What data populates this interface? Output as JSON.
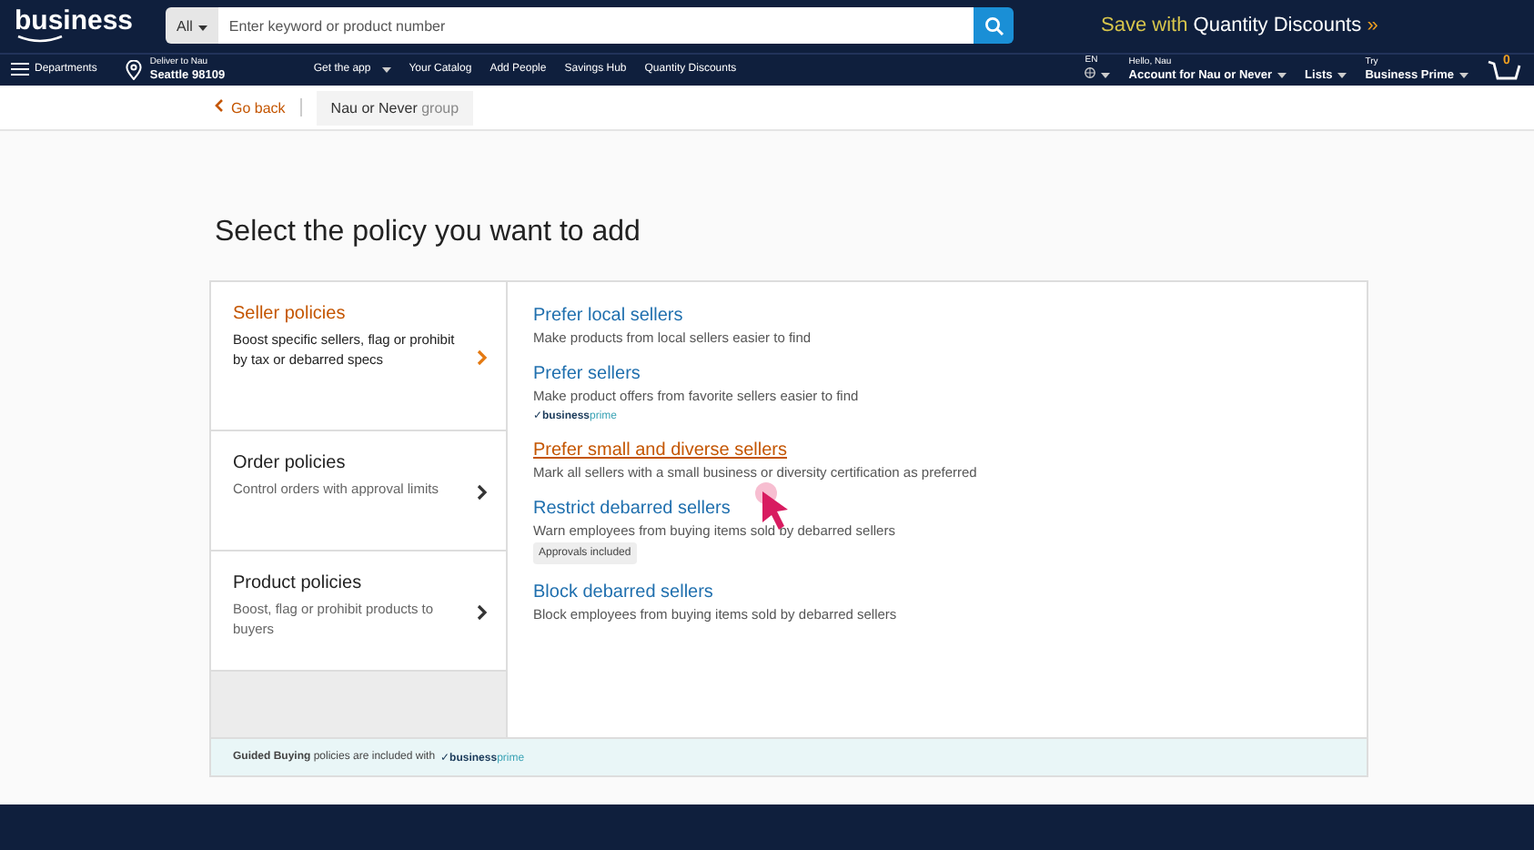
{
  "header": {
    "logo": "business",
    "search": {
      "scope": "All",
      "placeholder": "Enter keyword or product number"
    },
    "promo": {
      "lead": "Save with",
      "main": "Quantity Discounts",
      "arrow": "»"
    }
  },
  "nav": {
    "departments": "Departments",
    "deliver_line1": "Deliver to Nau",
    "deliver_line2": "Seattle 98109",
    "links": [
      {
        "label": "Get the app",
        "dropdown": true
      },
      {
        "label": "Your Catalog",
        "dropdown": false
      },
      {
        "label": "Add People",
        "dropdown": false
      },
      {
        "label": "Savings Hub",
        "dropdown": false
      },
      {
        "label": "Quantity Discounts",
        "dropdown": false
      }
    ],
    "language": "EN",
    "account_line1": "Hello, Nau",
    "account_line2": "Account for Nau or Never",
    "lists": "Lists",
    "prime_line1": "Try",
    "prime_line2": "Business Prime",
    "cart_count": "0"
  },
  "breadcrumb": {
    "back": "Go back",
    "group_name": "Nau or Never",
    "group_suffix": "group"
  },
  "title": "Select the policy you want to add",
  "categories": [
    {
      "title": "Seller policies",
      "description": "Boost specific sellers, flag or prohibit by tax or debarred specs",
      "selected": true
    },
    {
      "title": "Order policies",
      "description": "Control orders with approval limits",
      "selected": false
    },
    {
      "title": "Product policies",
      "description": "Boost, flag or prohibit products to buyers",
      "selected": false
    }
  ],
  "policies": [
    {
      "title": "Prefer local sellers",
      "description": "Make products from local sellers easier to find",
      "hovered": false
    },
    {
      "title": "Prefer sellers",
      "description": "Make product offers from favorite sellers easier to find",
      "hovered": false,
      "badge": {
        "kind": "prime",
        "check": "✓",
        "bold": "business",
        "light": "prime"
      }
    },
    {
      "title": "Prefer small and diverse sellers",
      "description": "Mark all sellers with a small business or diversity certification as preferred",
      "hovered": true
    },
    {
      "title": "Restrict debarred sellers",
      "description": "Warn employees from buying items sold by debarred sellers",
      "hovered": false,
      "badge": {
        "kind": "tag",
        "text": "Approvals included"
      }
    },
    {
      "title": "Block debarred sellers",
      "description": "Block employees from buying items sold by debarred sellers",
      "hovered": false
    }
  ],
  "note": {
    "text": "**Guided Buying** policies are included with",
    "badge": {
      "kind": "prime",
      "check": "✓",
      "bold": "business",
      "light": "prime"
    }
  }
}
